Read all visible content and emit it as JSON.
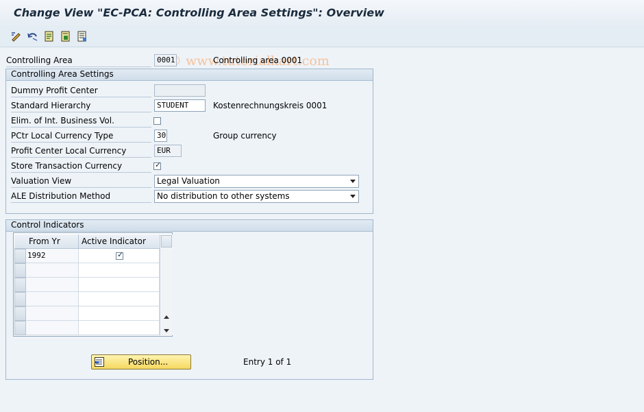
{
  "window": {
    "title": "Change View \"EC-PCA: Controlling Area Settings\": Overview"
  },
  "watermark": "© www.tutorialkart.com",
  "toolbar": {
    "icons": [
      "display-change-icon",
      "undo-icon",
      "choose-icon",
      "save-icon",
      "detail-icon"
    ]
  },
  "header": {
    "controlling_area_label": "Controlling Area",
    "controlling_area_value": "0001",
    "controlling_area_desc": "Controlling area 0001"
  },
  "settings": {
    "title": "Controlling Area Settings",
    "dummy_profit_center_label": "Dummy Profit Center",
    "dummy_profit_center_value": "",
    "standard_hierarchy_label": "Standard Hierarchy",
    "standard_hierarchy_value": "STUDENT",
    "standard_hierarchy_desc": "Kostenrechnungskreis 0001",
    "elim_label": "Elim. of Int. Business Vol.",
    "elim_checked": false,
    "pctr_currency_type_label": "PCtr Local Currency Type",
    "pctr_currency_type_value": "30",
    "pctr_currency_type_desc": "Group currency",
    "pc_local_currency_label": "Profit Center Local Currency",
    "pc_local_currency_value": "EUR",
    "store_txn_currency_label": "Store Transaction Currency",
    "store_txn_currency_checked": true,
    "valuation_view_label": "Valuation View",
    "valuation_view_value": "Legal Valuation",
    "ale_method_label": "ALE Distribution Method",
    "ale_method_value": "No distribution to other systems"
  },
  "control_indicators": {
    "title": "Control Indicators",
    "columns": [
      "From Yr",
      "Active Indicator"
    ],
    "rows": [
      {
        "from_yr": "1992",
        "active": true
      }
    ]
  },
  "footer": {
    "position_button": "Position...",
    "entry_text": "Entry 1 of 1"
  },
  "colors": {
    "background": "#eef3f8",
    "group_border": "#9fb6cb",
    "button_yellow": "#f5d860",
    "watermark": "#f5c29a"
  }
}
